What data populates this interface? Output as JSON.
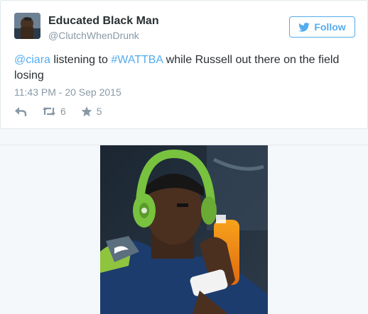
{
  "tweet": {
    "author_name": "Educated Black Man",
    "author_handle": "@ClutchWhenDrunk",
    "follow_label": "Follow",
    "text_parts": [
      {
        "text": "@ciara",
        "link": true
      },
      {
        "text": " listening to ",
        "link": false
      },
      {
        "text": "#WATTBA",
        "link": true
      },
      {
        "text": " while Russell out there on the field losing",
        "link": false
      }
    ],
    "timestamp": "11:43 PM - 20 Sep 2015",
    "retweet_count": "6",
    "favorite_count": "5"
  },
  "colors": {
    "accent": "#55acee",
    "muted": "#8899a6",
    "text": "#292f33",
    "background": "#f5f8fa"
  },
  "icons": {
    "follow": "twitter-bird-icon",
    "reply": "reply-icon",
    "retweet": "retweet-icon",
    "favorite": "star-icon"
  },
  "media": {
    "description_icon": "photo",
    "headphone_color": "#7cc142"
  }
}
